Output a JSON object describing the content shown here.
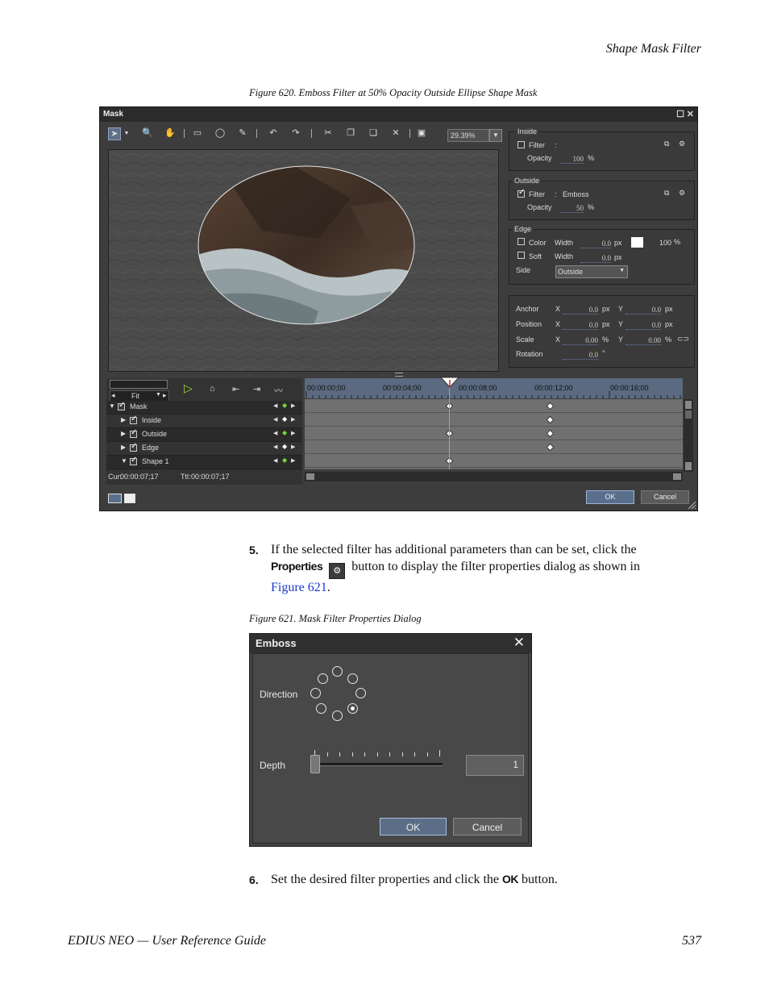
{
  "header": {
    "section_title": "Shape Mask Filter"
  },
  "figure620": {
    "caption": "Figure 620.  Emboss Filter at 50% Opacity Outside Ellipse Shape Mask",
    "window": {
      "title": "Mask",
      "zoom": "29.39%",
      "inside": {
        "group": "Inside",
        "filter_label": "Filter",
        "filter_sep": ":",
        "opacity_label": "Opacity",
        "opacity_value": "100",
        "unit": "%"
      },
      "outside": {
        "group": "Outside",
        "filter_label": "Filter",
        "filter_sep": ":",
        "filter_value": "Emboss",
        "opacity_label": "Opacity",
        "opacity_value": "50",
        "unit": "%"
      },
      "edge": {
        "group": "Edge",
        "color_label": "Color",
        "color_width_label": "Width",
        "color_width_value": "0.0",
        "px": "px",
        "color_opacity": "100",
        "unit": "%",
        "soft_label": "Soft",
        "soft_width_label": "Width",
        "soft_width_value": "0.0",
        "side_label": "Side",
        "side_value": "Outside"
      },
      "transform": {
        "anchor_label": "Anchor",
        "position_label": "Position",
        "scale_label": "Scale",
        "rotation_label": "Rotation",
        "x": "X",
        "y": "Y",
        "zero": "0.0",
        "zero2": "0.00",
        "px": "px",
        "pct": "%",
        "deg": "°"
      },
      "timeline": {
        "fit_label": "Fit",
        "tracks": [
          "Mask",
          "Inside",
          "Outside",
          "Edge",
          "Shape 1"
        ],
        "ruler": [
          "00:00:00;00",
          "00:00:04;00",
          "00:00:08;00",
          "00:00:12;00",
          "00:00:16;00"
        ],
        "cur_label": "Cur:",
        "cur_value": "00:00:07;17",
        "ttl_label": "Ttl:",
        "ttl_value": "00:00:07;17"
      },
      "ok_label": "OK",
      "cancel_label": "Cancel"
    }
  },
  "step5": {
    "number": "5.",
    "text_a": "If the selected filter has additional parameters than can be set, click the",
    "properties_label": "Properties",
    "text_b": "button to display the filter properties dialog as shown in",
    "link_text": "Figure 621",
    "text_c": "."
  },
  "figure621": {
    "caption": "Figure 621.  Mask Filter Properties Dialog",
    "dialog": {
      "title": "Emboss",
      "direction_label": "Direction",
      "selected_direction": "bottom-right",
      "depth_label": "Depth",
      "depth_value": "1",
      "ok_label": "OK",
      "cancel_label": "Cancel"
    }
  },
  "step6": {
    "number": "6.",
    "text_a": "Set the desired filter properties and click the",
    "ok_label": "OK",
    "text_b": "button."
  },
  "footer": {
    "guide_title": "EDIUS NEO  —  User Reference Guide",
    "page_number": "537"
  },
  "colors": {
    "link": "#1a38c9",
    "window_bg": "#3d3d3d",
    "ruler_bg": "#5b6a80",
    "playhead": "#c82b2b"
  }
}
